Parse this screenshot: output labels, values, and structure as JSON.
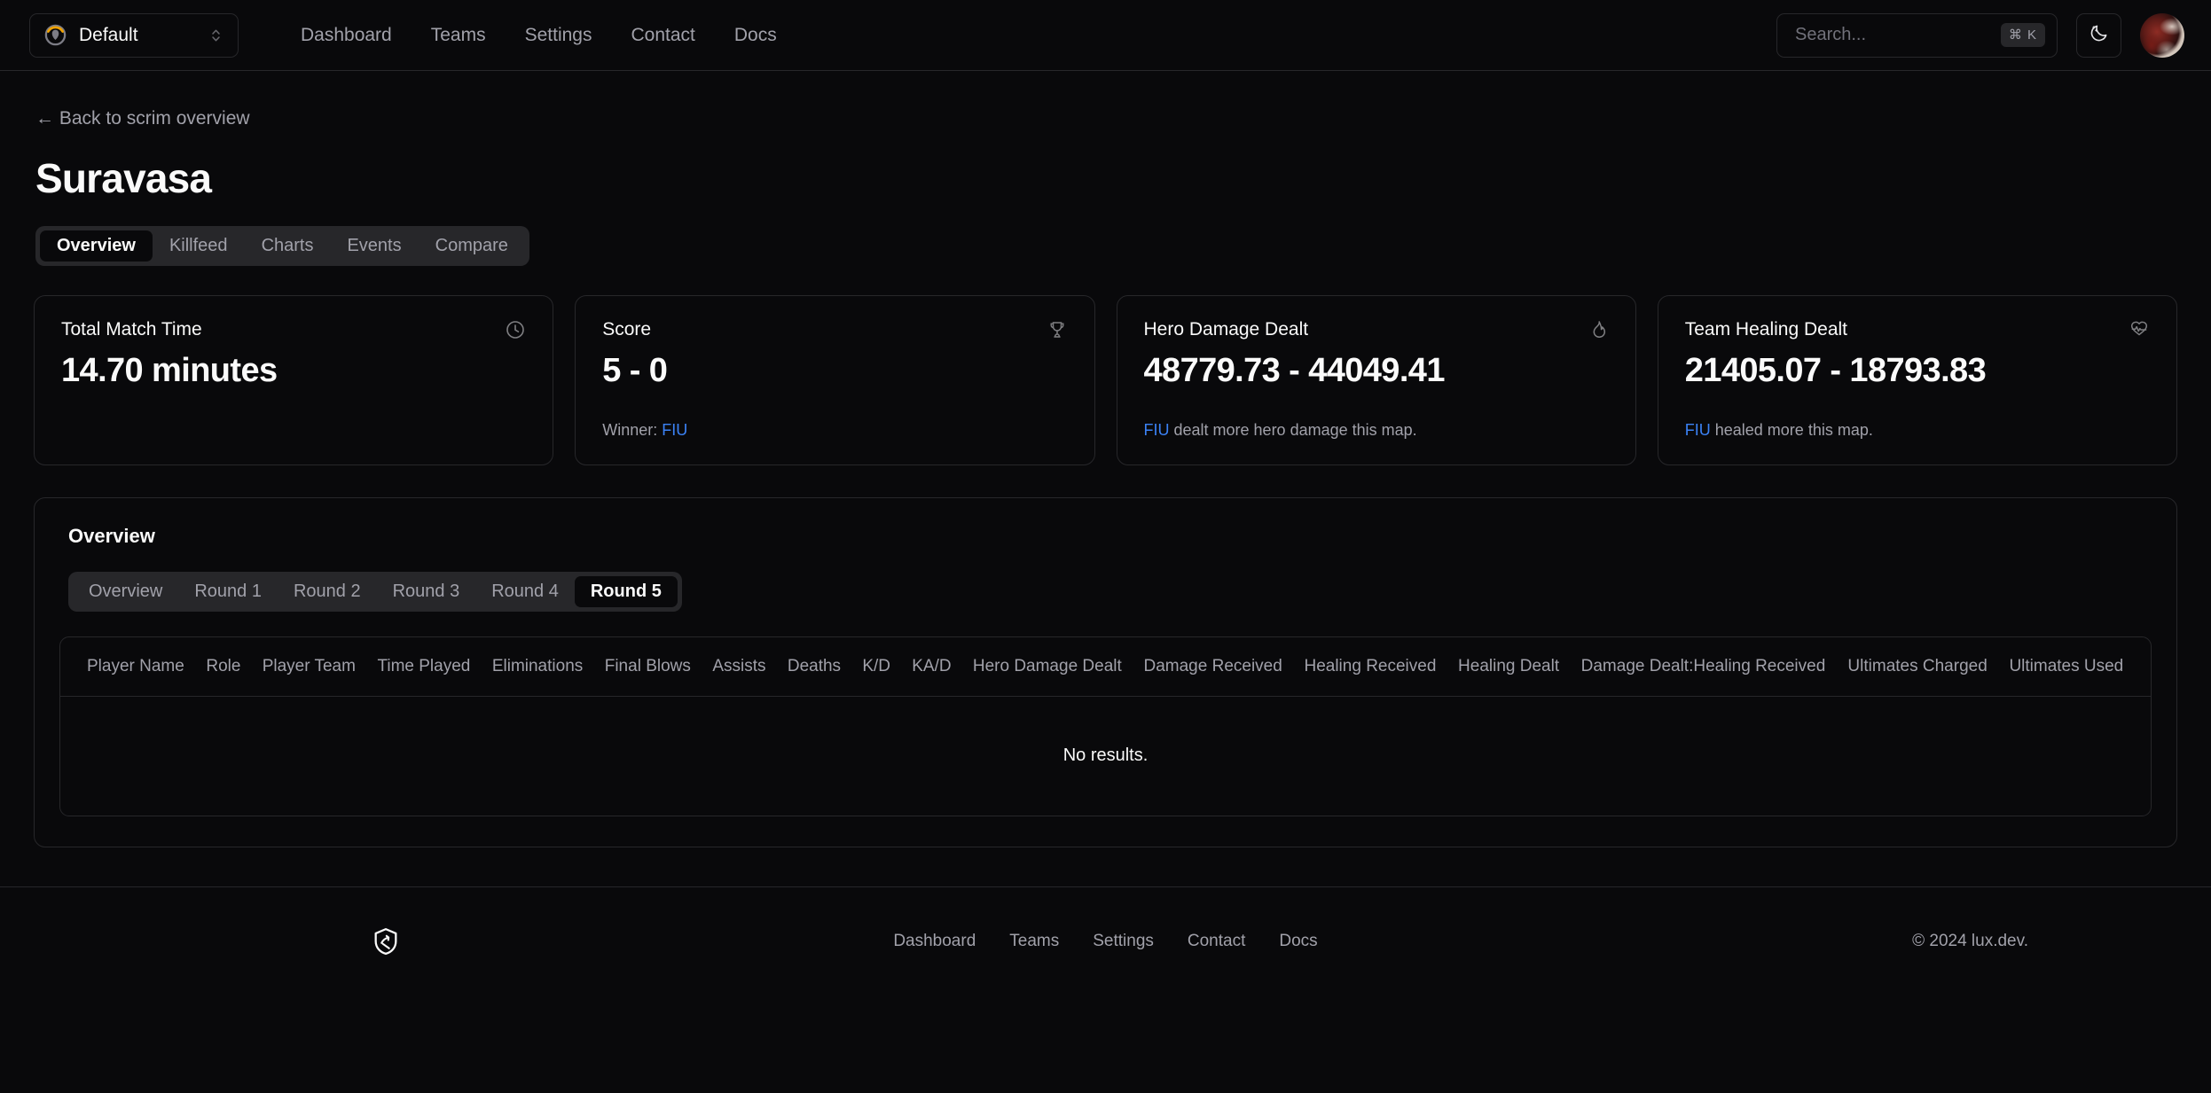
{
  "navbar": {
    "org_switcher": {
      "label": "Default",
      "icon": "overwatch-logo-icon",
      "chevron": "chevron-up-down-icon"
    },
    "links": [
      {
        "label": "Dashboard"
      },
      {
        "label": "Teams"
      },
      {
        "label": "Settings"
      },
      {
        "label": "Contact"
      },
      {
        "label": "Docs"
      }
    ],
    "search": {
      "placeholder": "Search...",
      "shortcut": "⌘ K"
    },
    "theme_toggle": {
      "icon": "moon-icon"
    },
    "avatar": {
      "icon": "user-avatar"
    }
  },
  "header": {
    "back_link": "← Back to scrim overview",
    "title": "Suravasa",
    "tabs": [
      {
        "label": "Overview",
        "active": true
      },
      {
        "label": "Killfeed",
        "active": false
      },
      {
        "label": "Charts",
        "active": false
      },
      {
        "label": "Events",
        "active": false
      },
      {
        "label": "Compare",
        "active": false
      }
    ]
  },
  "stats": [
    {
      "label": "Total Match Time",
      "value": "14.70 minutes",
      "icon": "clock-icon",
      "sub_prefix": "",
      "sub_team": "",
      "sub_suffix": ""
    },
    {
      "label": "Score",
      "value": "5 - 0",
      "icon": "trophy-icon",
      "sub_prefix": "Winner: ",
      "sub_team": "FIU",
      "sub_suffix": ""
    },
    {
      "label": "Hero Damage Dealt",
      "value": "48779.73 - 44049.41",
      "icon": "flame-icon",
      "sub_prefix": "",
      "sub_team": "FIU",
      "sub_suffix": " dealt more hero damage this map."
    },
    {
      "label": "Team Healing Dealt",
      "value": "21405.07 - 18793.83",
      "icon": "heart-pulse-icon",
      "sub_prefix": "",
      "sub_team": "FIU",
      "sub_suffix": " healed more this map."
    }
  ],
  "panel": {
    "title": "Overview",
    "round_tabs": [
      {
        "label": "Overview",
        "active": false
      },
      {
        "label": "Round 1",
        "active": false
      },
      {
        "label": "Round 2",
        "active": false
      },
      {
        "label": "Round 3",
        "active": false
      },
      {
        "label": "Round 4",
        "active": false
      },
      {
        "label": "Round 5",
        "active": true
      }
    ],
    "table": {
      "columns": [
        "Player Name",
        "Role",
        "Player Team",
        "Time Played",
        "Eliminations",
        "Final Blows",
        "Assists",
        "Deaths",
        "K/D",
        "KA/D",
        "Hero Damage Dealt",
        "Damage Received",
        "Healing Received",
        "Healing Dealt",
        "Damage Dealt:Healing Received",
        "Ultimates Charged",
        "Ultimates Used"
      ],
      "rows": [],
      "empty_message": "No results."
    }
  },
  "footer": {
    "logo": "shield-logo-icon",
    "links": [
      {
        "label": "Dashboard"
      },
      {
        "label": "Teams"
      },
      {
        "label": "Settings"
      },
      {
        "label": "Contact"
      },
      {
        "label": "Docs"
      }
    ],
    "copyright": "© 2024 lux.dev."
  },
  "colors": {
    "background": "#09090b",
    "border": "#27272a",
    "muted_text": "#a1a1aa",
    "accent_link": "#3b82f6",
    "logo_gold": "#f0a202"
  }
}
